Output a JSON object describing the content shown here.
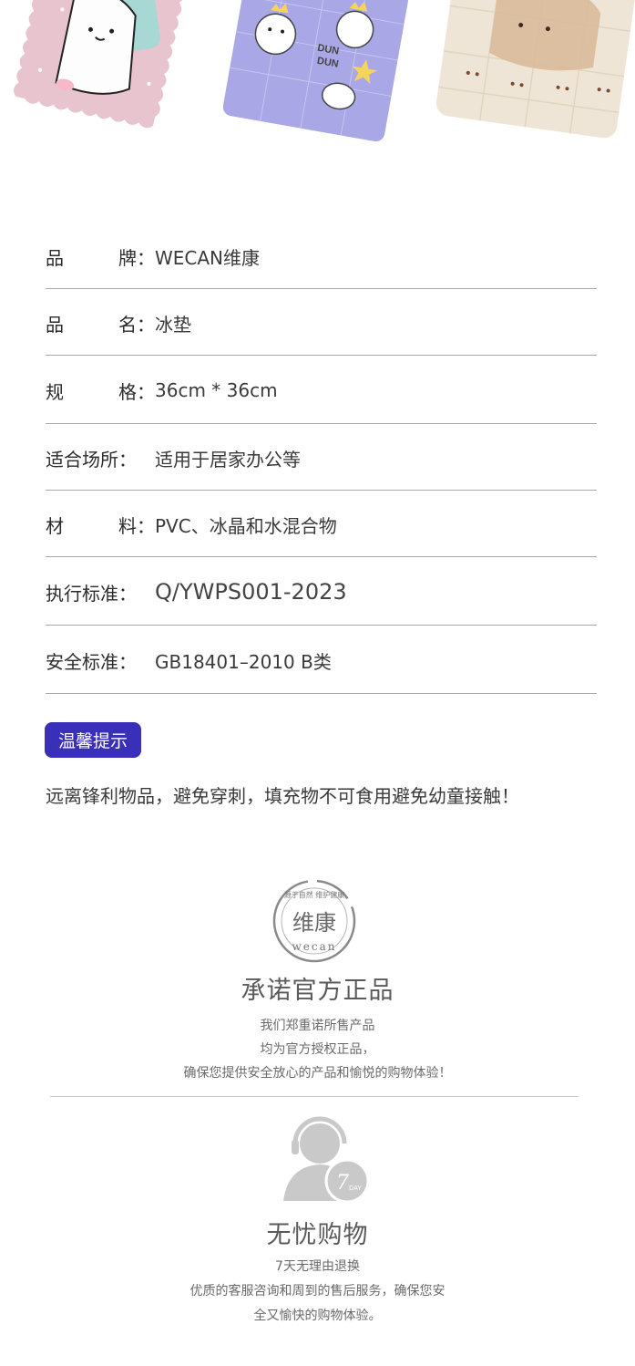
{
  "hero": {
    "pad_center_text": "DUN\nDUN"
  },
  "specs": [
    {
      "label_chars": [
        "品",
        "牌："
      ],
      "value": "WECAN维康"
    },
    {
      "label_chars": [
        "品",
        "名："
      ],
      "value": "冰垫"
    },
    {
      "label_chars": [
        "规",
        "格："
      ],
      "value": "36cm * 36cm"
    },
    {
      "label_chars": [
        "适合场所："
      ],
      "value": "适用于居家办公等"
    },
    {
      "label_chars": [
        "材",
        "料："
      ],
      "value": "PVC、冰晶和水混合物"
    },
    {
      "label_chars": [
        "执行标准："
      ],
      "value": "Q/YWPS001-2023"
    },
    {
      "label_chars": [
        "安全标准："
      ],
      "value": "GB18401–2010 B类"
    }
  ],
  "tip": {
    "badge": "温馨提示",
    "text": "远离锋利物品，避免穿刺，填充物不可食用避免幼童接触！"
  },
  "guarantee": {
    "seal_top": "源于自然 维护健康",
    "seal_main": "维康",
    "seal_bottom": "wecan",
    "title": "承诺官方正品",
    "lines": [
      "我们郑重诺所售产品",
      "均为官方授权正品，",
      "确保您提供安全放心的产品和愉悦的购物体验！"
    ]
  },
  "service": {
    "badge_num": "7",
    "badge_unit": "DAY",
    "title": "无忧购物",
    "lines": [
      "7天无理由退换",
      "优质的客服咨询和周到的售后服务，确保您安",
      "全又愉快的购物体验。"
    ]
  },
  "colors": {
    "accent": "#3a2fb8",
    "pad_pink": "#e8c4cf",
    "pad_purple": "#a9a7e6",
    "pad_cream": "#efe5d6"
  }
}
